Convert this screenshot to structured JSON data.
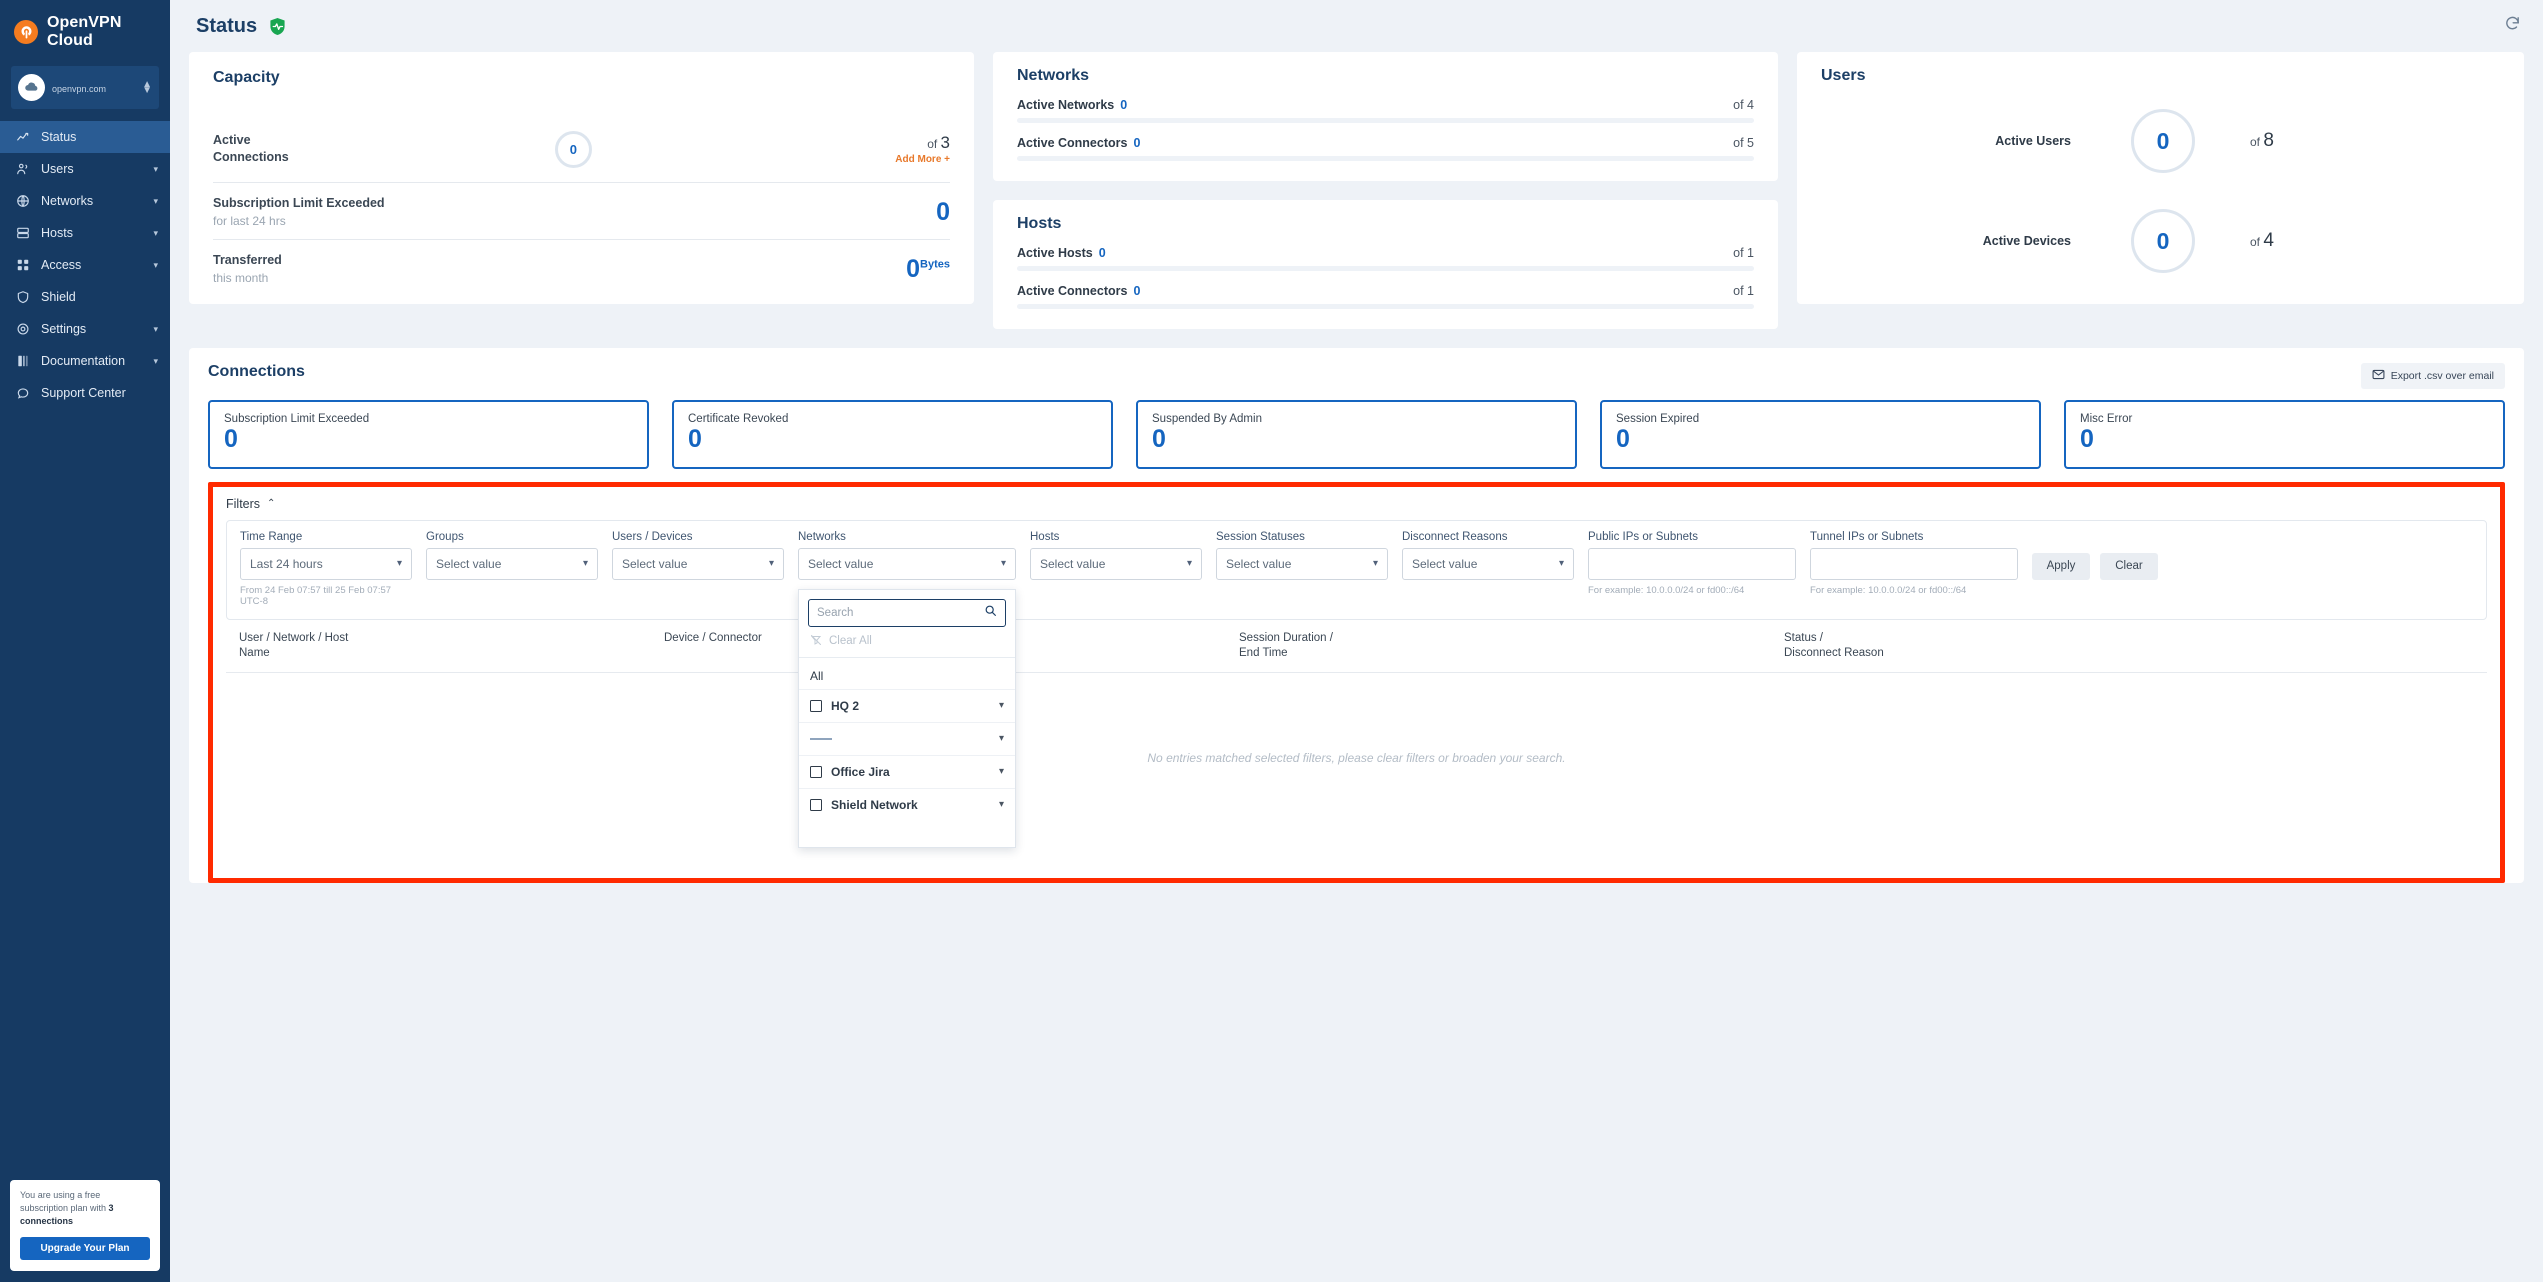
{
  "sidebar": {
    "brand": "OpenVPN Cloud",
    "org": {
      "domain": "openvpn.com",
      "name_redacted": ""
    },
    "items": [
      {
        "label": "Status",
        "icon": "chart-line-icon",
        "active": true,
        "expandable": false
      },
      {
        "label": "Users",
        "icon": "users-icon",
        "active": false,
        "expandable": true
      },
      {
        "label": "Networks",
        "icon": "globe-icon",
        "active": false,
        "expandable": true
      },
      {
        "label": "Hosts",
        "icon": "server-icon",
        "active": false,
        "expandable": true
      },
      {
        "label": "Access",
        "icon": "grid-icon",
        "active": false,
        "expandable": true
      },
      {
        "label": "Shield",
        "icon": "shield-icon",
        "active": false,
        "expandable": false
      },
      {
        "label": "Settings",
        "icon": "gear-icon",
        "active": false,
        "expandable": true
      },
      {
        "label": "Documentation",
        "icon": "book-icon",
        "active": false,
        "expandable": true
      },
      {
        "label": "Support Center",
        "icon": "chat-bubble-icon",
        "active": false,
        "expandable": false
      }
    ],
    "upsell": {
      "text_before": "You are using a free subscription plan with ",
      "text_bold": "3 connections",
      "button": "Upgrade Your Plan"
    }
  },
  "header": {
    "title": "Status",
    "badge_icon": "green-shield-pulse-icon",
    "refresh_icon": "refresh-icon"
  },
  "capacity": {
    "title": "Capacity",
    "rows": [
      {
        "label_line1": "Active",
        "label_line2": "Connections",
        "donut_value": "0",
        "of_prefix": "of ",
        "of_value": "3",
        "add_more": "Add More +"
      },
      {
        "label_line1": "Subscription Limit Exceeded",
        "sub": "for last 24 hrs",
        "value": "0"
      },
      {
        "label_line1": "Transferred",
        "sub": "this month",
        "value": "0",
        "unit": "Bytes"
      }
    ]
  },
  "networks": {
    "title": "Networks",
    "rows": [
      {
        "label": "Active Networks",
        "value": "0",
        "of": "of 4"
      },
      {
        "label": "Active Connectors",
        "value": "0",
        "of": "of 5"
      }
    ]
  },
  "hosts": {
    "title": "Hosts",
    "rows": [
      {
        "label": "Active Hosts",
        "value": "0",
        "of": "of 1"
      },
      {
        "label": "Active Connectors",
        "value": "0",
        "of": "of 1"
      }
    ]
  },
  "users": {
    "title": "Users",
    "rows": [
      {
        "label": "Active Users",
        "value": "0",
        "of_prefix": "of ",
        "of_value": "8"
      },
      {
        "label": "Active Devices",
        "value": "0",
        "of_prefix": "of ",
        "of_value": "4"
      }
    ]
  },
  "connections": {
    "title": "Connections",
    "export_label": "Export .csv over email",
    "export_icon": "envelope-icon",
    "stats": [
      {
        "label": "Subscription Limit Exceeded",
        "value": "0"
      },
      {
        "label": "Certificate Revoked",
        "value": "0"
      },
      {
        "label": "Suspended By Admin",
        "value": "0"
      },
      {
        "label": "Session Expired",
        "value": "0"
      },
      {
        "label": "Misc Error",
        "value": "0"
      }
    ]
  },
  "filters": {
    "panel_label": "Filters",
    "collapse_icon": "chevron-up-icon",
    "time_range": {
      "label": "Time Range",
      "value": "Last 24 hours",
      "hint": "From 24 Feb 07:57 till 25 Feb 07:57 UTC-8"
    },
    "groups": {
      "label": "Groups",
      "value": "Select value"
    },
    "users_devices": {
      "label": "Users / Devices",
      "value": "Select value"
    },
    "networks": {
      "label": "Networks",
      "value": "Select value"
    },
    "hosts": {
      "label": "Hosts",
      "value": "Select value"
    },
    "session_statuses": {
      "label": "Session Statuses",
      "value": "Select value"
    },
    "disconnect_reasons": {
      "label": "Disconnect Reasons",
      "value": "Select value"
    },
    "public_ips": {
      "label": "Public IPs or Subnets",
      "value": "",
      "hint": "For example: 10.0.0.0/24 or fd00::/64"
    },
    "tunnel_ips": {
      "label": "Tunnel IPs or Subnets",
      "value": "",
      "hint": "For example: 10.0.0.0/24 or fd00::/64"
    },
    "apply_label": "Apply",
    "clear_label": "Clear",
    "networks_dropdown": {
      "search_placeholder": "Search",
      "search_value": "",
      "search_icon": "search-icon",
      "clear_all_label": "Clear All",
      "clear_all_icon": "filter-off-icon",
      "all_label": "All",
      "items": [
        {
          "label": "HQ 2",
          "checked": false,
          "expandable": true
        },
        {
          "label": "",
          "checked": false,
          "expandable": true,
          "placeholder_row": true
        },
        {
          "label": "Office Jira",
          "checked": false,
          "expandable": true
        },
        {
          "label": "Shield Network",
          "checked": false,
          "expandable": true
        }
      ]
    }
  },
  "table": {
    "columns": [
      {
        "line1": "User / Network / Host",
        "line2": "Name"
      },
      {
        "line1": "Device / Connector",
        "line2": ""
      },
      {
        "line1": "Session Duration /",
        "line2": "End Time"
      },
      {
        "line1": "Status /",
        "line2": "Disconnect Reason"
      }
    ],
    "empty_message": "No entries matched selected filters, please clear filters or broaden your search."
  },
  "colors": {
    "sidebar_bg": "#163a63",
    "accent_blue": "#1565c0",
    "title_blue": "#1c3f66",
    "orange": "#e8792b",
    "highlight_red": "#ff2a00",
    "page_bg": "#eef2f7"
  }
}
